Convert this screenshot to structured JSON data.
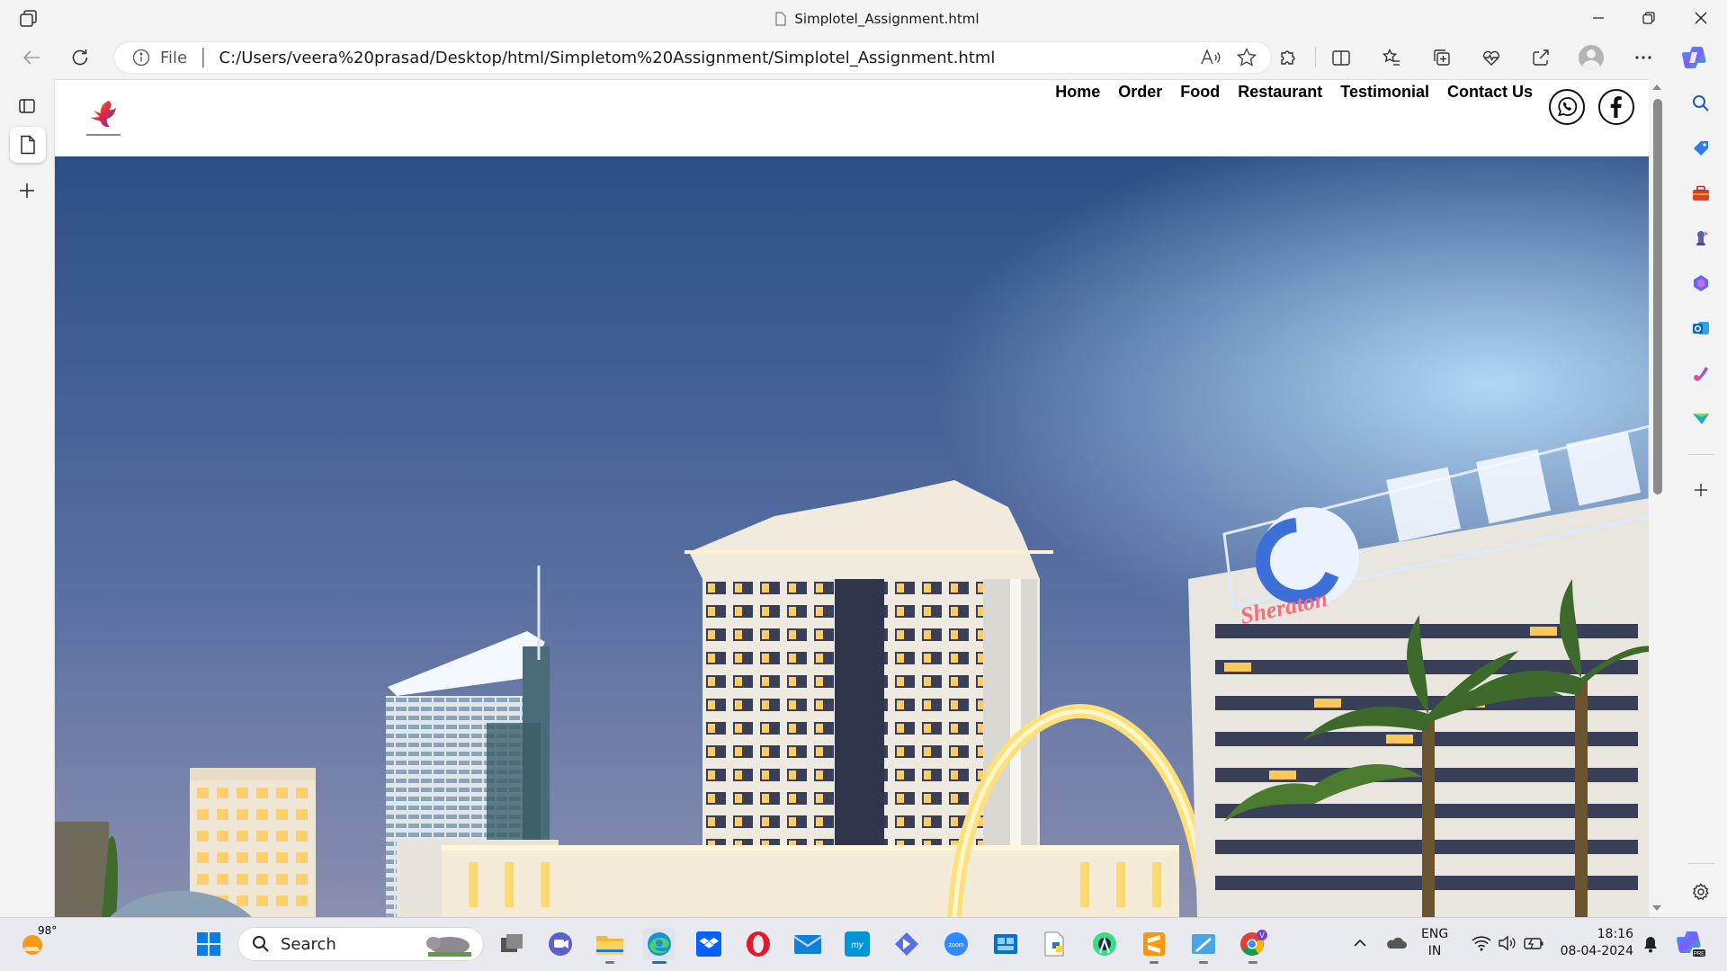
{
  "browser": {
    "window_title": "Simplotel_Assignment.html",
    "address": {
      "scheme_label": "File",
      "url": "C:/Users/veera%20prasad/Desktop/html/Simpletom%20Assignment/Simplotel_Assignment.html"
    }
  },
  "site": {
    "nav": [
      "Home",
      "Order",
      "Food",
      "Restaurant",
      "Testimonial",
      "Contact Us"
    ],
    "hero_sign_text": "Sheraton"
  },
  "taskbar": {
    "weather_temp": "98°",
    "search_label": "Search",
    "language_top": "ENG",
    "language_bottom": "IN",
    "time": "18:16",
    "date": "08-04-2024"
  },
  "colors": {
    "accent": "#0078d4",
    "sky_top": "#2c5289",
    "sky_bottom": "#7a89ad"
  }
}
